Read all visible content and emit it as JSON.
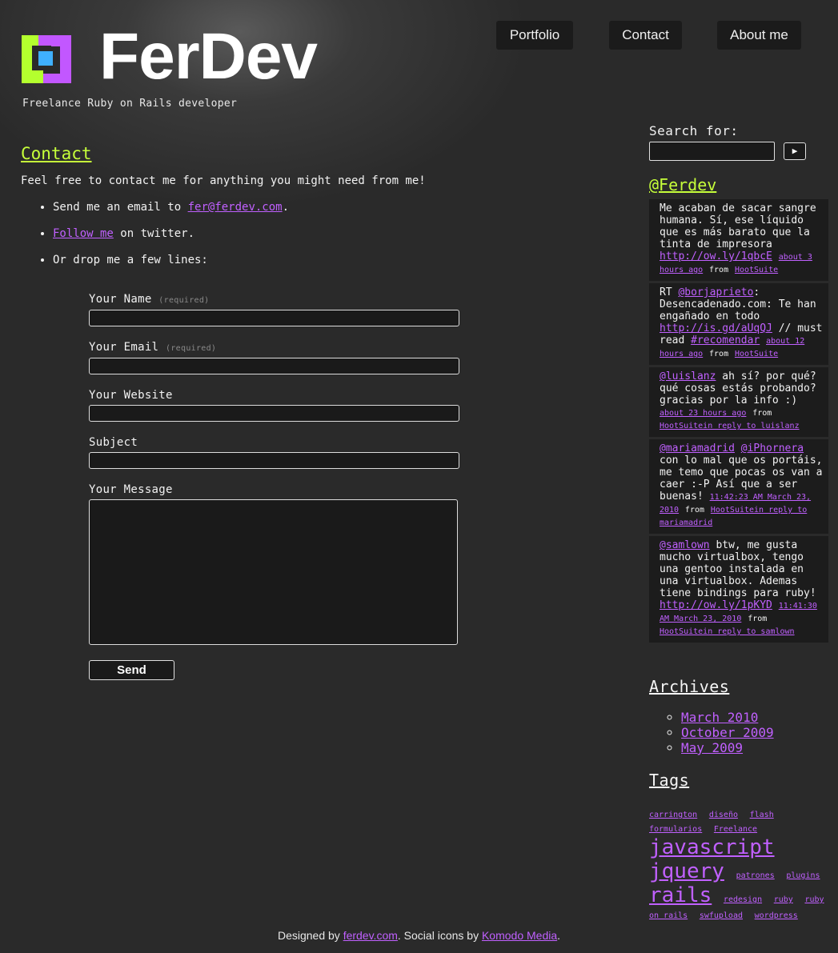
{
  "header": {
    "site_title": "FerDev",
    "tagline": "Freelance Ruby on Rails developer",
    "nav": [
      "Portfolio",
      "Contact",
      "About me"
    ]
  },
  "main": {
    "title": "Contact",
    "intro": "Feel free to contact me for anything you might need from me!",
    "list": {
      "email_prefix": "Send me an email to",
      "email_link": "fer@ferdev.com",
      "email_suffix": ".",
      "follow_link": "Follow me",
      "follow_suffix": "on twitter.",
      "drop_lines": "Or drop me a few lines:"
    },
    "form": {
      "name_label": "Your Name",
      "required_note": "(required)",
      "email_label": "Your Email",
      "website_label": "Your Website",
      "subject_label": "Subject",
      "message_label": "Your Message",
      "send_label": "Send"
    }
  },
  "sidebar": {
    "search_label": "Search for:",
    "search_button": "▶",
    "twitter_heading": "@Ferdev",
    "tweets": [
      {
        "text": "Me acaban de sacar sangre humana. Sí, ese líquido que es más barato que la tinta de impresora",
        "link": "http://ow.ly/1qbcE",
        "time": "about 3 hours ago",
        "from": "from",
        "source": "HootSuite"
      },
      {
        "rt": "RT",
        "mention": "@borjaprieto",
        "text": ": Desencadenado.com: Te han engañado en todo",
        "link": "http://is.gd/aUqQJ",
        "text2": "// must read",
        "hashtag": "#recomendar",
        "time": "about 12 hours ago",
        "from": "from",
        "source": "HootSuite"
      },
      {
        "mention": "@luislanz",
        "text": "ah sí? por qué? qué cosas estás probando? gracias por la info :)",
        "time": "about 23 hours ago",
        "from": "from",
        "source": "HootSuitein reply to luislanz"
      },
      {
        "mention": "@mariamadrid",
        "mention2": "@iPhornera",
        "text": "con lo mal que os portáis, me temo que pocas os van a caer :-P Así que a ser buenas!",
        "time": "11:42:23 AM March 23, 2010",
        "from": "from",
        "source": "HootSuitein reply to mariamadrid"
      },
      {
        "mention": "@samlown",
        "text": "btw, me gusta mucho virtualbox, tengo una gentoo instalada en una virtualbox. Ademas tiene bindings para ruby!",
        "link": "http://ow.ly/1pKYD",
        "time": "11:41:30 AM March 23, 2010",
        "from": "from",
        "source": "HootSuitein reply to samlown"
      }
    ],
    "archives_heading": "Archives",
    "archives": [
      "March 2010",
      "October 2009",
      "May 2009"
    ],
    "tags_heading": "Tags",
    "tags": [
      {
        "label": "carrington",
        "size": 10
      },
      {
        "label": "diseño",
        "size": 10
      },
      {
        "label": "flash",
        "size": 10
      },
      {
        "label": "formularios",
        "size": 10
      },
      {
        "label": "Freelance",
        "size": 10
      },
      {
        "label": "javascript",
        "size": 26
      },
      {
        "label": "jquery",
        "size": 26
      },
      {
        "label": "patrones",
        "size": 10
      },
      {
        "label": "plugins",
        "size": 10
      },
      {
        "label": "rails",
        "size": 26
      },
      {
        "label": "redesign",
        "size": 10
      },
      {
        "label": "ruby",
        "size": 10
      },
      {
        "label": "ruby on rails",
        "size": 10
      },
      {
        "label": "swfupload",
        "size": 10
      },
      {
        "label": "wordpress",
        "size": 10
      }
    ]
  },
  "footer": {
    "designed_by": "Designed by",
    "designer_link": "ferdev.com",
    "icons_text": ". Social icons by",
    "icons_link": "Komodo Media",
    "end": "."
  },
  "colors": {
    "background": "#2a2a2a",
    "accent_green": "#c6ff3a",
    "link_purple": "#c060ff",
    "logo_blue": "#3fb0ff"
  }
}
